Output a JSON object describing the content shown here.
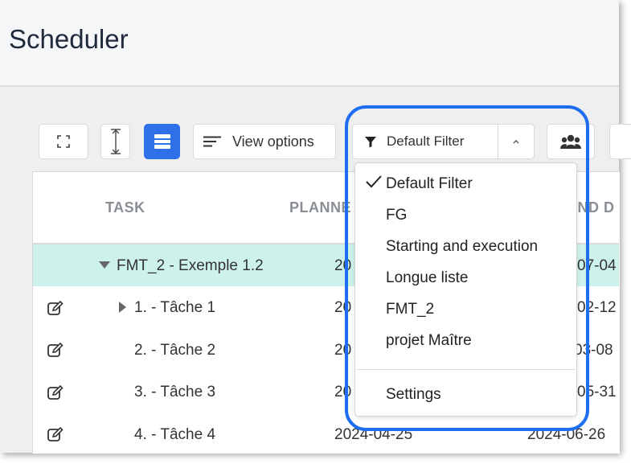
{
  "header": {
    "title": "Scheduler"
  },
  "toolbar": {
    "view_options_label": "View options",
    "filter_label": "Default Filter"
  },
  "grid": {
    "columns": {
      "task": "TASK",
      "planned": "PLANNE",
      "end": "END D"
    },
    "rows": [
      {
        "task": "FMT_2 - Exemple 1.2",
        "planned": "20",
        "end": "07-04"
      },
      {
        "task": "1. - Tâche 1",
        "planned": "20",
        "end": "02-12"
      },
      {
        "task": "2. - Tâche 2",
        "planned": "20",
        "end": "03-08"
      },
      {
        "task": "3. - Tâche 3",
        "planned": "20",
        "end": "05-31"
      },
      {
        "task": "4. - Tâche 4",
        "planned": "2024-04-25",
        "end": "2024-06-26"
      }
    ]
  },
  "filter_menu": {
    "items": [
      "Default Filter",
      "FG",
      "Starting and execution",
      "Longue liste",
      "FMT_2",
      "projet Maître"
    ],
    "settings_label": "Settings",
    "selected": "Default Filter"
  },
  "colors": {
    "accent": "#2f6fe8",
    "highlight_ring": "#1e6ef2",
    "selected_row": "#cdf2ec"
  },
  "icons": [
    "fullscreen-icon",
    "row-height-icon",
    "list-view-icon",
    "lines-icon",
    "filter-icon",
    "chevron-up-icon",
    "users-icon",
    "edit-icon",
    "caret-down-icon",
    "caret-right-icon",
    "checkmark-icon"
  ]
}
